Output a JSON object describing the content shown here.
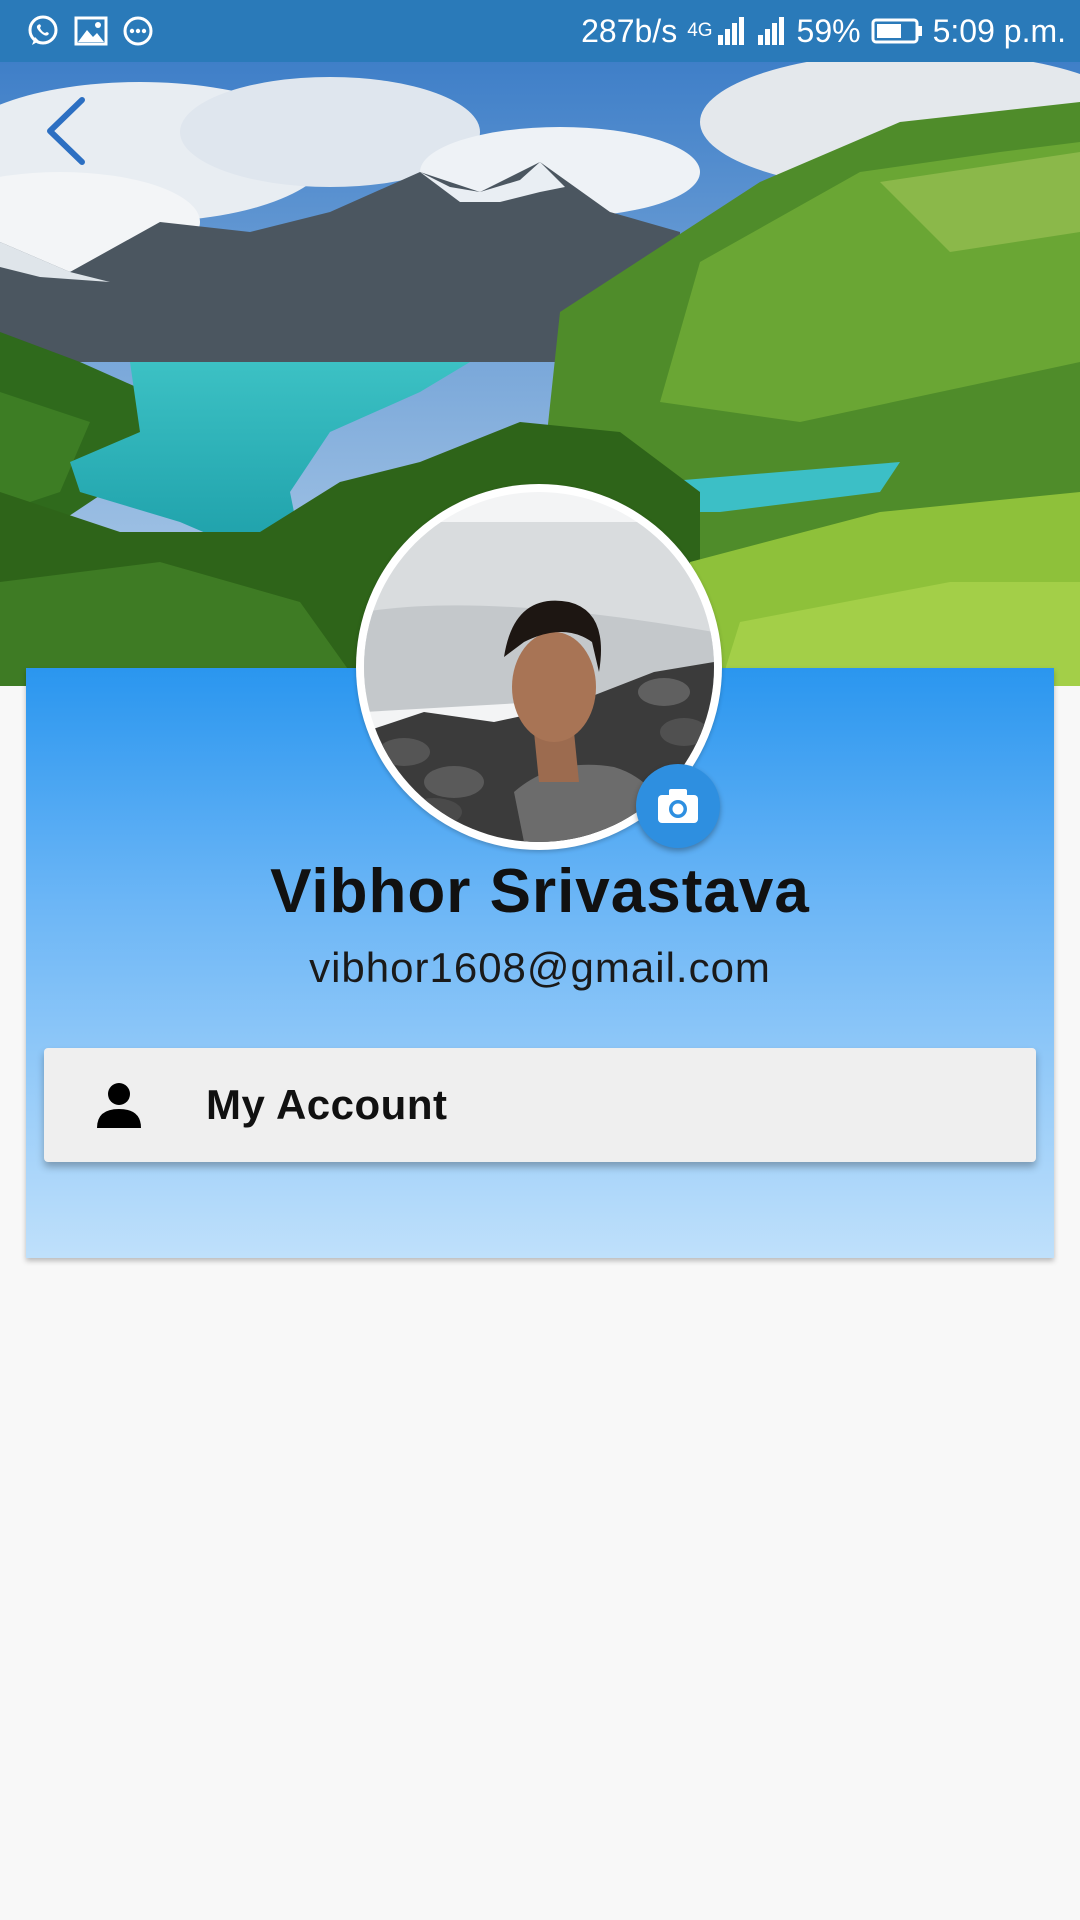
{
  "status_bar": {
    "icons_left": [
      "whatsapp-icon",
      "gallery-icon",
      "more-options-icon"
    ],
    "network_speed": "287b/s",
    "network_type": "4G",
    "battery_percent": "59%",
    "time": "5:09 p.m."
  },
  "navigation": {
    "back_icon": "chevron-left-icon"
  },
  "profile": {
    "name": "Vibhor Srivastava",
    "email": "vibhor1608@gmail.com",
    "camera_icon": "camera-icon"
  },
  "menu": {
    "items": [
      {
        "label": "My Account",
        "icon": "person-icon"
      }
    ]
  },
  "colors": {
    "status_bar": "#2a7ab9",
    "card_gradient_top": "#2a96ef",
    "card_gradient_bottom": "#bfe0fb",
    "accent": "#2e8fe0",
    "back_arrow": "#2c6fc2",
    "row_background": "#efefef",
    "page_background": "#f8f8f8"
  }
}
